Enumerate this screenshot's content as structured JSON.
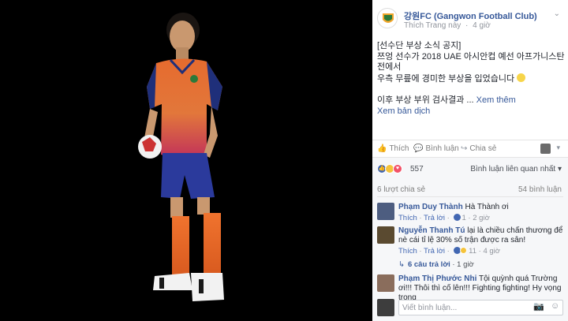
{
  "post": {
    "page_name": "강원FC (Gangwon Football Club)",
    "like_page": "Thích Trang này",
    "dot": "·",
    "time": "4 giờ",
    "chevron": "⌄",
    "lines": [
      "[선수단 부상 소식 공지]",
      "쯔엉 선수가 2018 UAE 아시안컵 예선 아프가니스탄",
      "전에서",
      "우측 무릎에 경미한 부상을 입었습니다"
    ],
    "line5_text": "이후 부상 부위 검사결과 ...",
    "see_more": "Xem thêm",
    "translate": "Xem bản dịch"
  },
  "actions": {
    "like": "Thích",
    "comment": "Bình luận",
    "share": "Chia sẻ"
  },
  "stats": {
    "reaction_count": "557",
    "relevant": "Bình luận liên quan nhất ▾",
    "shares": "6 lượt chia sẻ",
    "comments": "54 bình luận"
  },
  "comments": [
    {
      "name": "Phạm Duy Thành",
      "text": "Hà Thành ơi",
      "like": "Thích",
      "reply": "Trả lời",
      "count": "1",
      "time": "2 giờ"
    },
    {
      "name": "Nguyễn Thanh Tú",
      "text": "lại là chiều chấn thương để nè cái tỉ lệ 30% số trận được ra sân!",
      "like": "Thích",
      "reply": "Trả lời",
      "count": "11",
      "time": "4 giờ"
    },
    {
      "name": "Phạm Thị Phước Nhi",
      "text": "Tội quỳnh quá Trường ơi!!! Thôi thì cố lên!!! Fighting fighting! Hy vọng trong",
      "like": "",
      "reply": "",
      "count": "",
      "time": ""
    }
  ],
  "replies": {
    "count_text": "6 câu trả lời",
    "dot": "·",
    "time": "1 giờ"
  },
  "write": {
    "placeholder": "Viết bình luận..."
  },
  "colors": {
    "link": "#365899",
    "orange": "#e8672a",
    "navy": "#1f2f7a"
  },
  "icons": [
    "logo-icon",
    "like-icon",
    "comment-icon",
    "share-icon",
    "camera-icon",
    "sticker-icon"
  ]
}
